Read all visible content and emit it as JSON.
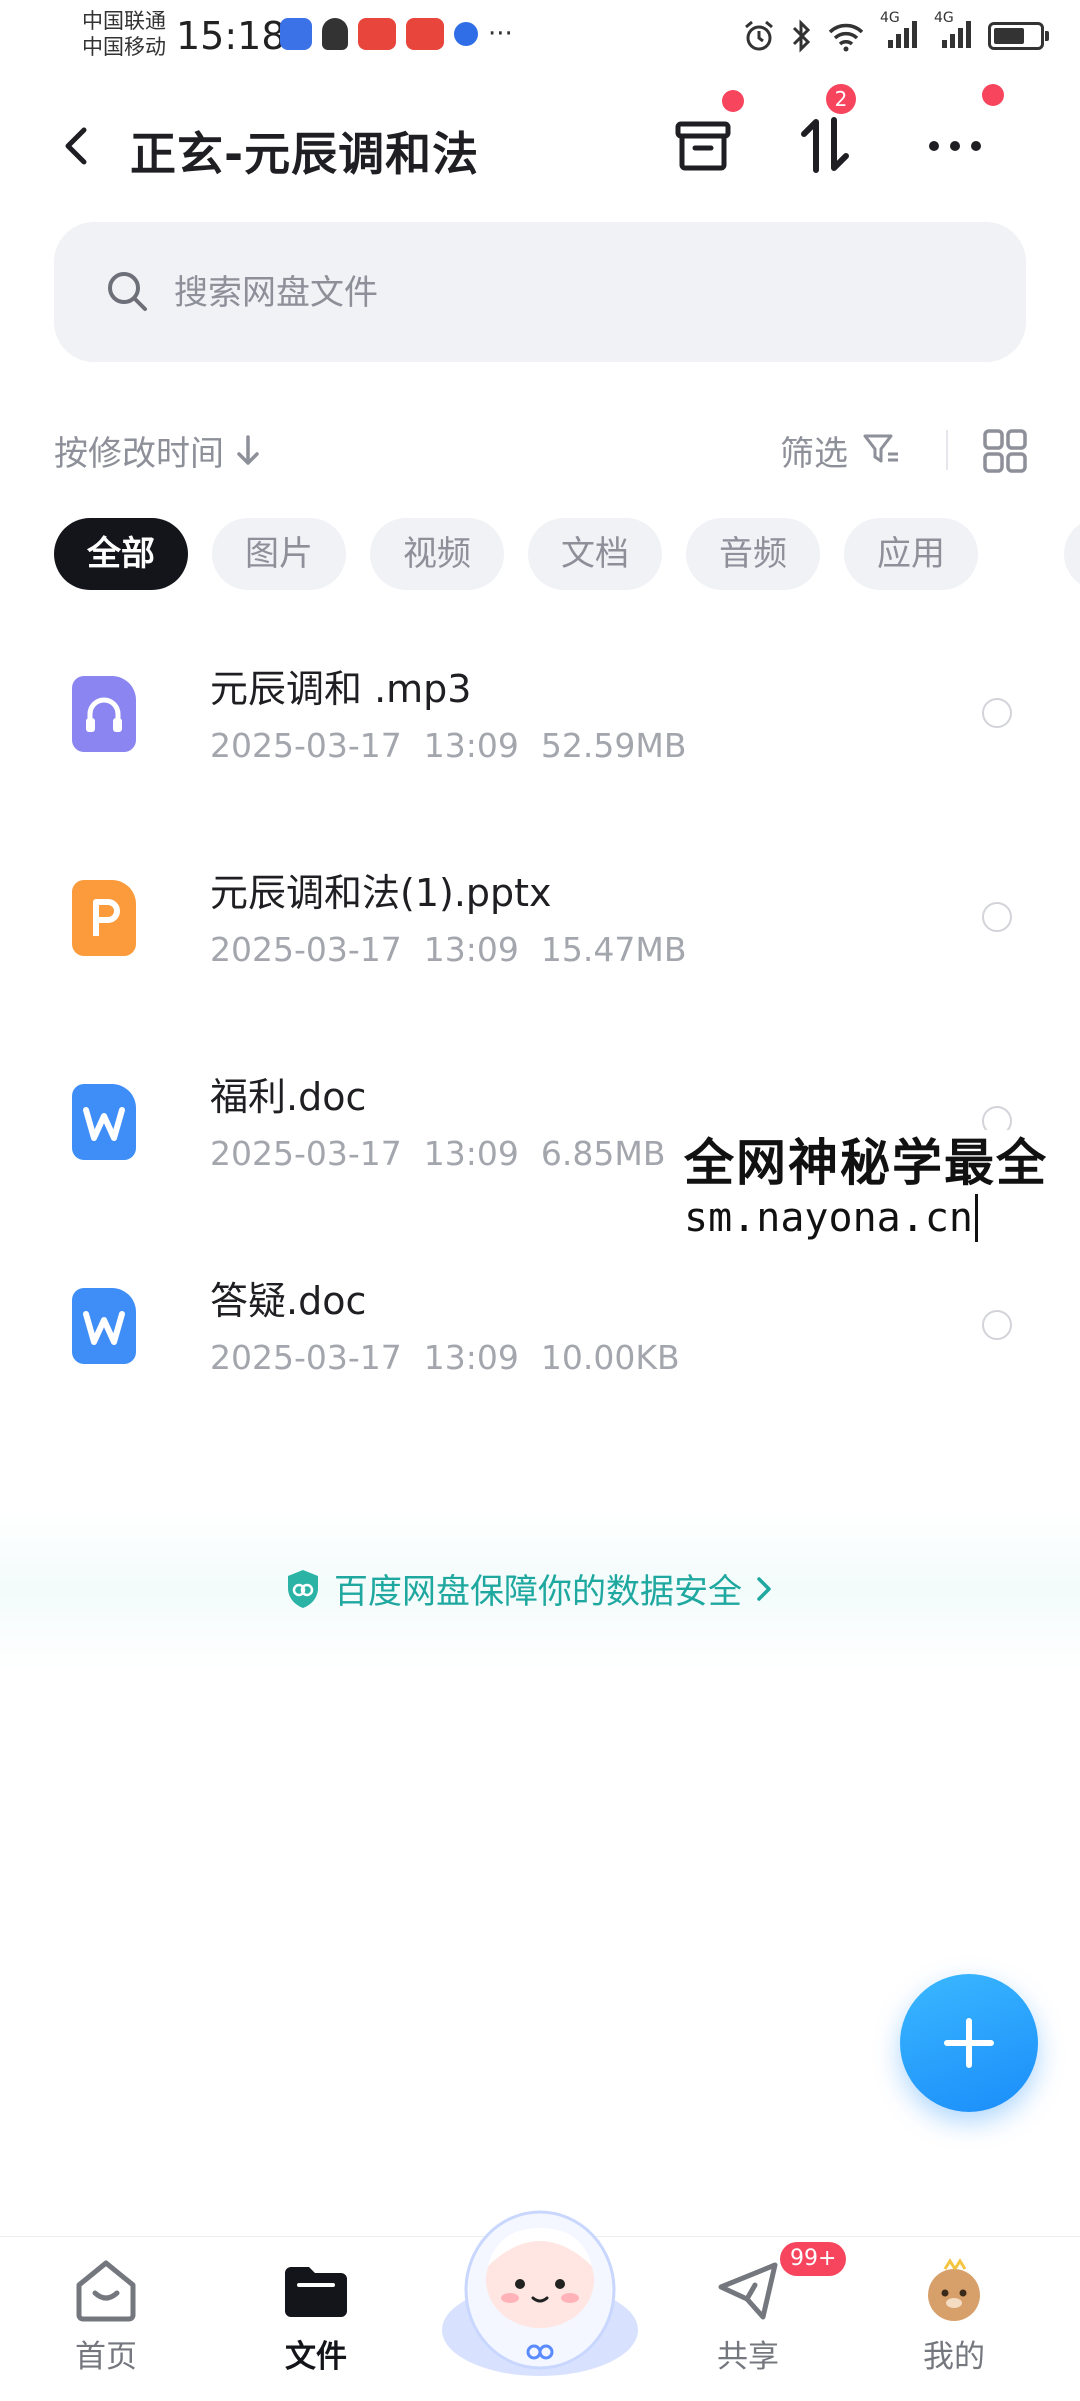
{
  "status_bar": {
    "carrier_1": "中国联通",
    "carrier_2": "中国移动",
    "time": "15:18",
    "network_1": "4G",
    "network_2": "4G"
  },
  "header": {
    "title": "正玄-元辰调和法",
    "transfer_badge": "2"
  },
  "search": {
    "placeholder": "搜索网盘文件"
  },
  "sort_bar": {
    "sort_label": "按修改时间",
    "filter_label": "筛选"
  },
  "tabs": [
    {
      "label": "全部",
      "active": true
    },
    {
      "label": "图片"
    },
    {
      "label": "视频"
    },
    {
      "label": "文档"
    },
    {
      "label": "音频"
    },
    {
      "label": "应用"
    }
  ],
  "files": [
    {
      "name": "元辰调和 .mp3",
      "date": "2025-03-17",
      "time": "13:09",
      "size": "52.59MB",
      "icon": "audio-file-icon",
      "color": "#8a85f0"
    },
    {
      "name": "元辰调和法(1).pptx",
      "date": "2025-03-17",
      "time": "13:09",
      "size": "15.47MB",
      "icon": "ppt-file-icon",
      "color": "#fb9b3c"
    },
    {
      "name": "福利.doc",
      "date": "2025-03-17",
      "time": "13:09",
      "size": "6.85MB",
      "icon": "word-file-icon",
      "color": "#3f8ef7"
    },
    {
      "name": "答疑.doc",
      "date": "2025-03-17",
      "time": "13:09",
      "size": "10.00KB",
      "icon": "word-file-icon",
      "color": "#3f8ef7"
    }
  ],
  "watermark": {
    "line1": "全网神秘学最全",
    "line2": "sm.nayona.cn"
  },
  "safety_note": "百度网盘保障你的数据安全",
  "nav": [
    {
      "label": "首页"
    },
    {
      "label": "文件",
      "active": true
    },
    {
      "label": "共享",
      "badge": "99+"
    },
    {
      "label": "我的"
    }
  ],
  "colors": {
    "accent_blue": "#1a8dfa",
    "badge_red": "#f7455e",
    "safety_teal": "#1fa89f",
    "active_tab": "#14151b"
  }
}
